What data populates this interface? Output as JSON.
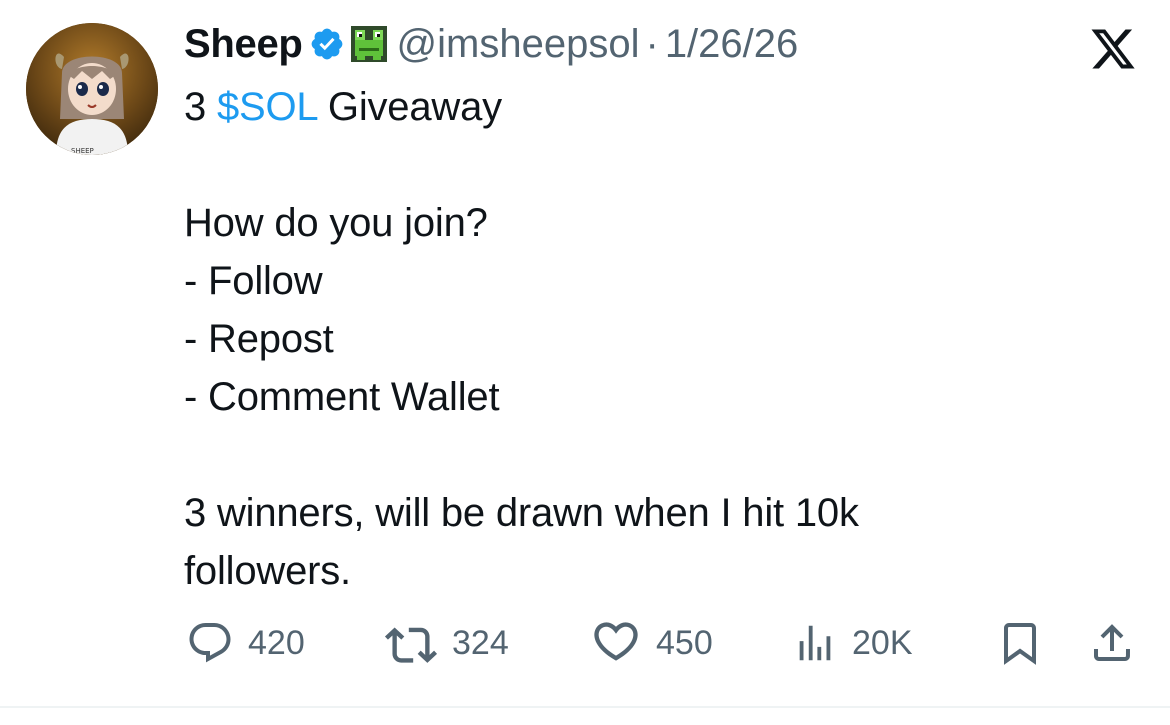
{
  "author": {
    "name": "Sheep",
    "handle": "@imsheepsol",
    "separator": "·",
    "date": "1/26/26",
    "avatar_shirt_text": "SHEEP"
  },
  "tweet": {
    "line1_prefix": "3",
    "line1_cashtag": "$SOL",
    "line1_suffix": "Giveaway",
    "line2": "How do you join?",
    "line3": "- Follow",
    "line4": "- Repost",
    "line5": "- Comment Wallet",
    "line6": "3 winners, will be drawn when I hit 10k",
    "line7": "followers."
  },
  "actions": {
    "replies": "420",
    "reposts": "324",
    "likes": "450",
    "views": "20K"
  },
  "icons": {
    "verified": "verified-badge-icon",
    "frog": "frog-emoji-icon",
    "platform": "x-logo-icon",
    "reply": "reply-icon",
    "repost": "repost-icon",
    "like": "heart-icon",
    "views": "views-icon",
    "bookmark": "bookmark-icon",
    "share": "share-icon"
  },
  "colors": {
    "text": "#0f1419",
    "muted": "#536471",
    "link": "#1d9bf0",
    "verified": "#1d9bf0"
  }
}
